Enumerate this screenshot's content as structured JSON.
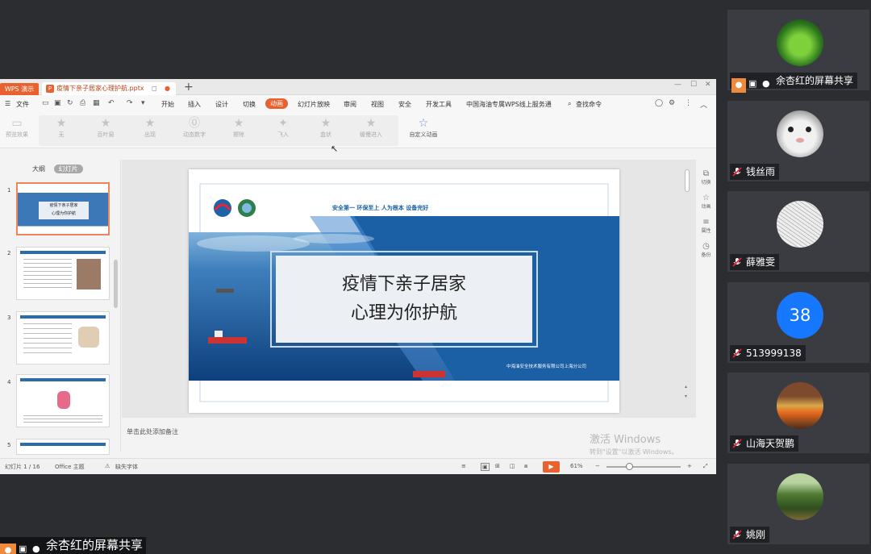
{
  "wps": {
    "app_tab": "WPS 演示",
    "doc_tab": "疫情下亲子居家心理护航.pptx",
    "menu": {
      "file": "文件",
      "tabs": [
        "开始",
        "插入",
        "设计",
        "切换",
        "动画",
        "幻灯片放映",
        "审阅",
        "视图",
        "安全",
        "开发工具",
        "中国海油专属WPS线上服务通"
      ],
      "search": "查找命令"
    },
    "ribbon": {
      "preview": "预览效果",
      "effects": [
        "无",
        "百叶窗",
        "出现",
        "动态数字",
        "擦除",
        "飞入",
        "盒状",
        "缓慢进入"
      ],
      "custom": "自定义动画"
    },
    "left_pane": {
      "outline_tab": "大纲",
      "slides_tab": "幻灯片",
      "numbers": [
        "1",
        "2",
        "3",
        "4",
        "5"
      ]
    },
    "slide": {
      "slogan": "安全第一  环保至上  人为根本  设备完好",
      "title_line1": "疫情下亲子居家",
      "title_line2": "心理为你护航",
      "company": "中海油安全技术服务有限公司上海分公司"
    },
    "thumb1_title": "疫情下亲子居家",
    "thumb1_sub": "心理为你护航",
    "side_tools": [
      "切换",
      "动画",
      "属性",
      "备份"
    ],
    "notes_placeholder": "单击此处添加备注",
    "status": {
      "slide_count": "幻灯片 1 / 16",
      "theme": "Office 主题",
      "missing_font": "缺失字体",
      "zoom": "61%"
    },
    "watermark": {
      "line1": "激活 Windows",
      "line2": "转到\"设置\"以激活 Windows。"
    }
  },
  "participants": [
    {
      "name": "余杏红的屏幕共享",
      "icon": "plant-avatar",
      "role": "sharer"
    },
    {
      "name": "钱丝雨",
      "icon": "cat-avatar",
      "role": "member"
    },
    {
      "name": "薛雅雯",
      "icon": "sketch-avatar",
      "role": "member"
    },
    {
      "name": "513999138",
      "avatar_text": "38",
      "role": "member",
      "color": "#1677ff"
    },
    {
      "name": "山海天贺鹏",
      "icon": "sunset-avatar",
      "role": "member"
    },
    {
      "name": "姚刚",
      "icon": "forest-avatar",
      "role": "member"
    }
  ],
  "share_banner": "余杏红的屏幕共享",
  "colors": {
    "accent": "#e8612f",
    "slide_blue": "#1b5fa5",
    "meeting_bg": "#2c2d31"
  }
}
